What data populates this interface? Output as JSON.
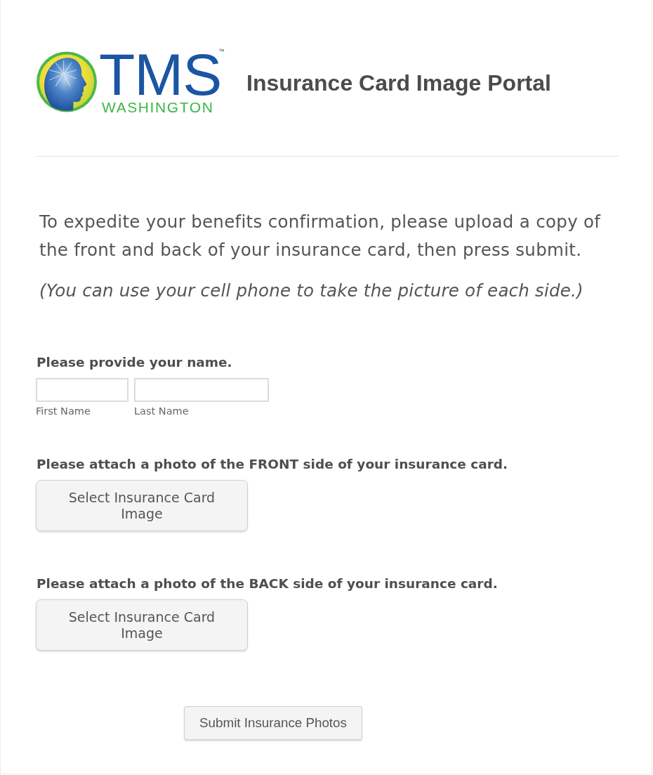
{
  "header": {
    "logo": {
      "wordmark": "TMS",
      "trademark": "™",
      "subtitle": "WASHINGTON"
    },
    "title": "Insurance Card Image Portal"
  },
  "intro": {
    "text": "To expedite your benefits confirmation, please upload a copy of the front and back of your insurance card, then press submit.",
    "note": "(You can use your cell phone to take the picture of each side.)"
  },
  "form": {
    "fields": [
      {
        "kind": "name",
        "label": "Please provide your name.",
        "inputs": [
          {
            "sublabel": "First Name"
          },
          {
            "sublabel": "Last Name"
          }
        ]
      },
      {
        "kind": "upload",
        "label": "Please attach a photo of the FRONT side of your insurance card.",
        "button": "Select Insurance Card Image"
      },
      {
        "kind": "upload",
        "label": "Please attach a photo of the BACK side of your insurance card.",
        "button": "Select Insurance Card Image"
      }
    ],
    "submit": "Submit Insurance Photos"
  }
}
